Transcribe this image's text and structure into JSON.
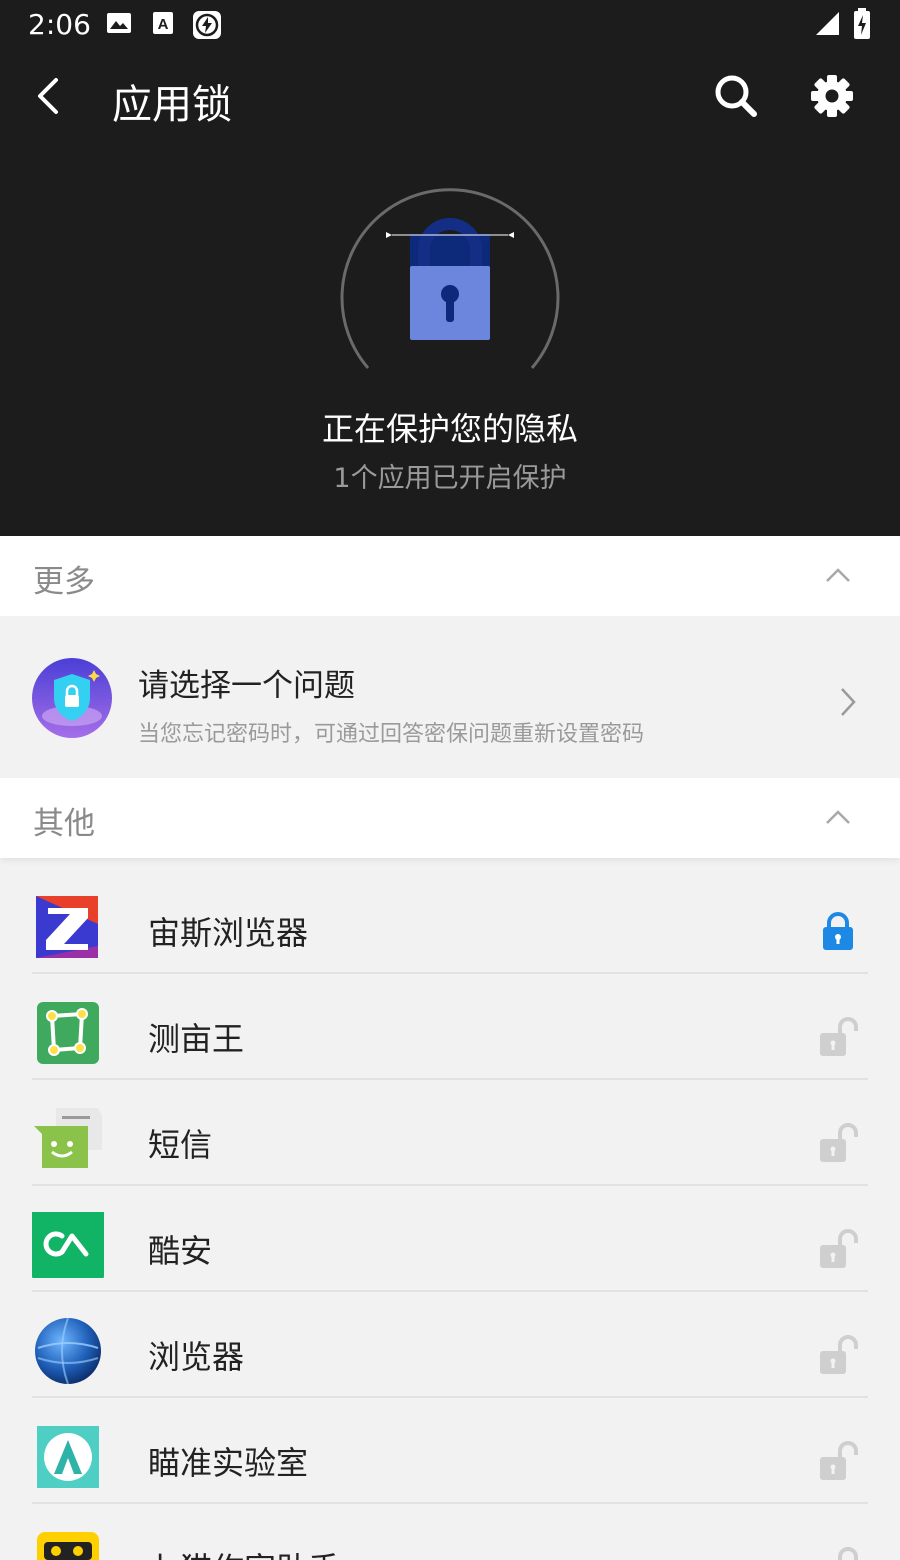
{
  "status_bar": {
    "time": "2:06",
    "icons": [
      "image-icon",
      "font-a-icon",
      "flash-icon",
      "signal-icon",
      "battery-charging-icon"
    ]
  },
  "toolbar": {
    "title": "应用锁",
    "icons": [
      "back-arrow-icon",
      "search-icon",
      "gear-icon"
    ]
  },
  "hero": {
    "title": "正在保护您的隐私",
    "subtitle": "1个应用已开启保护",
    "lock_color": "#6b86dc"
  },
  "sections": {
    "more": {
      "label": "更多"
    },
    "other": {
      "label": "其他"
    }
  },
  "security_question": {
    "title": "请选择一个问题",
    "description": "当您忘记密码时，可通过回答密保问题重新设置密码"
  },
  "apps": [
    {
      "name": "宙斯浏览器",
      "locked": true,
      "icon": "zeus-browser-icon"
    },
    {
      "name": "测亩王",
      "locked": false,
      "icon": "cemuwang-icon"
    },
    {
      "name": "短信",
      "locked": false,
      "icon": "messaging-icon"
    },
    {
      "name": "酷安",
      "locked": false,
      "icon": "coolapk-icon"
    },
    {
      "name": "浏览器",
      "locked": false,
      "icon": "browser-globe-icon"
    },
    {
      "name": "瞄准实验室",
      "locked": false,
      "icon": "aim-lab-icon"
    },
    {
      "name": "七猫作家助手",
      "locked": false,
      "icon": "qimao-writer-icon"
    }
  ],
  "colors": {
    "header_bg": "#1c1c1c",
    "locked_accent": "#1e88e5",
    "unlocked_gray": "#cfcfcf"
  }
}
